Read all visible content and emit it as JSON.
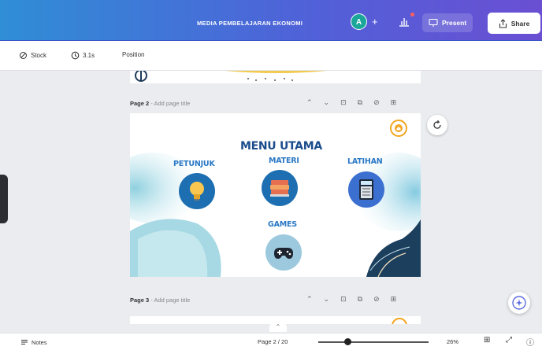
{
  "topbar": {
    "doc_title": "MEDIA PEMBELAJARAN EKONOMI",
    "avatar_initial": "A",
    "add_label": "+",
    "present_label": "Present",
    "share_label": "Share"
  },
  "toolbar": {
    "stock_label": "Stock",
    "duration_label": "3.1s",
    "position_label": "Position"
  },
  "pages": [
    {
      "number_label": "Page 2",
      "title_placeholder": "- Add page title"
    },
    {
      "number_label": "Page 3",
      "title_placeholder": "- Add page title"
    }
  ],
  "slide": {
    "heading": "MENU UTAMA",
    "items": [
      {
        "label": "PETUNJUK",
        "icon": "lightbulb-icon"
      },
      {
        "label": "MATERI",
        "icon": "book-stack-icon"
      },
      {
        "label": "LATIHAN",
        "icon": "calculator-icon"
      },
      {
        "label": "GAMES",
        "icon": "gamepad-icon"
      }
    ],
    "colors": {
      "heading": "#1b4d8c",
      "label": "#2a78c6",
      "circle": "#1d6fb2",
      "accent": "#f4a623"
    }
  },
  "bottombar": {
    "notes_label": "Notes",
    "page_indicator": "Page 2 / 20",
    "zoom_label": "26%"
  }
}
